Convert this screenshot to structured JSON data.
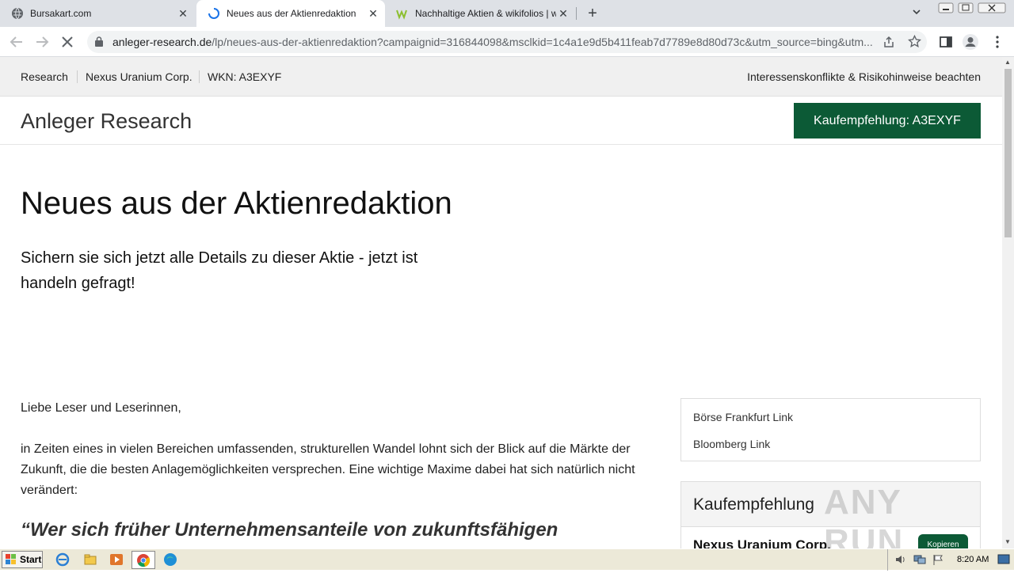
{
  "browser": {
    "tabs": [
      {
        "title": "Bursakart.com",
        "favicon": "globe-icon",
        "close": "✕"
      },
      {
        "title": "Neues aus der Aktienredaktion",
        "favicon": "loading-spinner-icon",
        "close": "✕"
      },
      {
        "title": "Nachhaltige Aktien & wikifolios | wiki",
        "favicon": "wikifolio-w-icon",
        "close": "✕"
      }
    ],
    "new_tab": "+",
    "url_host": "anleger-research.de",
    "url_path": "/lp/neues-aus-der-aktienredaktion?campaignid=316844098&msclkid=1c4a1e9d5b411feab7d7789e8d80d73c&utm_source=bing&utm..."
  },
  "topbar": {
    "crumbs": [
      "Research",
      "Nexus Uranium Corp.",
      "WKN: A3EXYF"
    ],
    "right_text": "Interessenskonflikte & Risikohinweise beachten"
  },
  "header": {
    "brand": "Anleger Research",
    "cta_label": "Kaufempfehlung: A3EXYF"
  },
  "hero": {
    "title": "Neues aus der Aktienredaktion",
    "subtitle": "Sichern sie sich jetzt alle Details zu dieser Aktie - jetzt ist handeln gefragt!"
  },
  "article": {
    "greeting": "Liebe Leser und Leserinnen,",
    "paragraph": "in Zeiten eines in vielen Bereichen umfassenden, strukturellen Wandel lohnt sich der Blick auf die Märkte der Zukunft, die die besten Anlagemöglichkeiten versprechen. Eine wichtige Maxime dabei hat sich natürlich nicht verändert:",
    "quote": "“Wer sich früher Unternehmensanteile von zukunftsfähigen"
  },
  "sidebar": {
    "links": [
      "Börse Frankfurt Link",
      "Bloomberg Link"
    ],
    "reco_title": "Kaufempfehlung",
    "reco_company": "Nexus Uranium Corp.",
    "copy_label": "Kopieren"
  },
  "watermark": "ANY RUN",
  "taskbar": {
    "start_label": "Start",
    "clock": "8:20 AM"
  }
}
